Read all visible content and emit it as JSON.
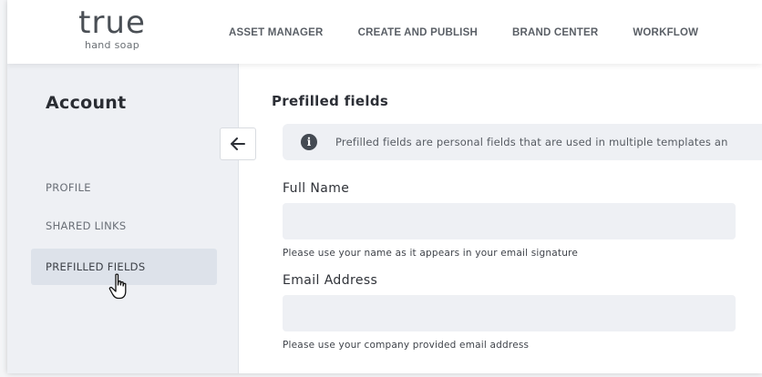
{
  "brand": {
    "name": "true",
    "tagline": "hand soap"
  },
  "nav": {
    "items": [
      {
        "label": "ASSET MANAGER"
      },
      {
        "label": "CREATE AND PUBLISH"
      },
      {
        "label": "BRAND CENTER"
      },
      {
        "label": "WORKFLOW"
      }
    ]
  },
  "sidebar": {
    "title": "Account",
    "items": [
      {
        "label": "PROFILE",
        "active": false
      },
      {
        "label": "SHARED LINKS",
        "active": false
      },
      {
        "label": "PREFILLED FIELDS",
        "active": true
      }
    ],
    "collapse_icon": "arrow-left-icon"
  },
  "main": {
    "title": "Prefilled fields",
    "info": {
      "icon": "info-icon",
      "text": "Prefilled fields are personal fields that are used in multiple templates an"
    },
    "fields": [
      {
        "label": "Full Name",
        "value": "",
        "help": "Please use your name as it appears in your email signature"
      },
      {
        "label": "Email Address",
        "value": "",
        "help": "Please use your company provided email address"
      }
    ]
  },
  "colors": {
    "sidebar_bg": "#eef0f4",
    "active_item_bg": "#dde2ea",
    "input_bg": "#eef0f4",
    "text_dark": "#2c2f36"
  }
}
